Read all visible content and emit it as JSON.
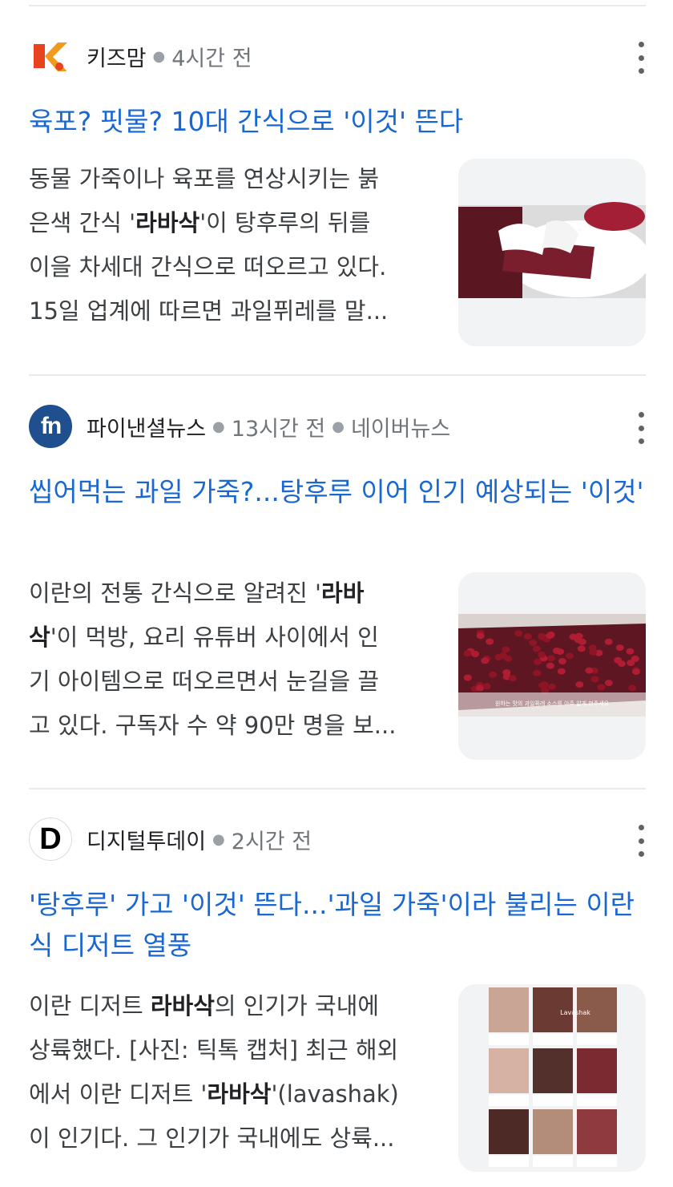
{
  "articles": [
    {
      "source": "키즈맘",
      "time": "4시간 전",
      "publisher": "",
      "title": "육포? 핏물? 10대 간식으로 '이것' 뜬다",
      "snippet": [
        "동물 가죽이나 육포를 연상시키는 붉",
        "은색 간식 '",
        "라바삭",
        "'이 탕후루의 뒤를",
        "이을 차세대 간식으로 떠오르고 있다.",
        "15일 업계에 따르면 과일퓌레를 말..."
      ],
      "logo_text": "K",
      "logo_icon": "kizmom-logo-icon"
    },
    {
      "source": "파이낸셜뉴스",
      "time": "13시간 전",
      "publisher": "네이버뉴스",
      "title": "씹어먹는 과일 가죽?...탕후루 이어 인기 예상되는 '이것'",
      "snippet": [
        "이란의 전통 간식으로 알려진 '",
        "라바",
        "삭",
        "'이 먹방, 요리 유튜버 사이에서 인",
        "기 아이템으로 떠오르면서 눈길을 끌",
        "고 있다. 구독자 수 약 90만 명을 보..."
      ],
      "logo_text": "fn",
      "logo_icon": "fn-logo-icon",
      "thumb_caption": "원하는 맛의 과일퓌레 소스를 아주 얇게 펴주세요"
    },
    {
      "source": "디지털투데이",
      "time": "2시간 전",
      "publisher": "",
      "title": "'탕후루' 가고 '이것' 뜬다...'과일 가죽'이라 불리는 이란식 디저트 열풍",
      "snippet": [
        "이란 디저트 ",
        "라바삭",
        "의 인기가 국내에",
        "상륙했다. [사진: 틱톡 캡처] 최근 해외",
        "에서 이란 디저트 '",
        "라바삭",
        "'(lavashak)",
        "이 인기다. 그 인기가 국내에도 상륙..."
      ],
      "logo_text": "D",
      "logo_icon": "digital-today-logo-icon",
      "thumb_caption": "Lavashak"
    }
  ],
  "colors": {
    "title": "#1967d2",
    "meta": "#70757a",
    "snippet": "#3c4043"
  }
}
